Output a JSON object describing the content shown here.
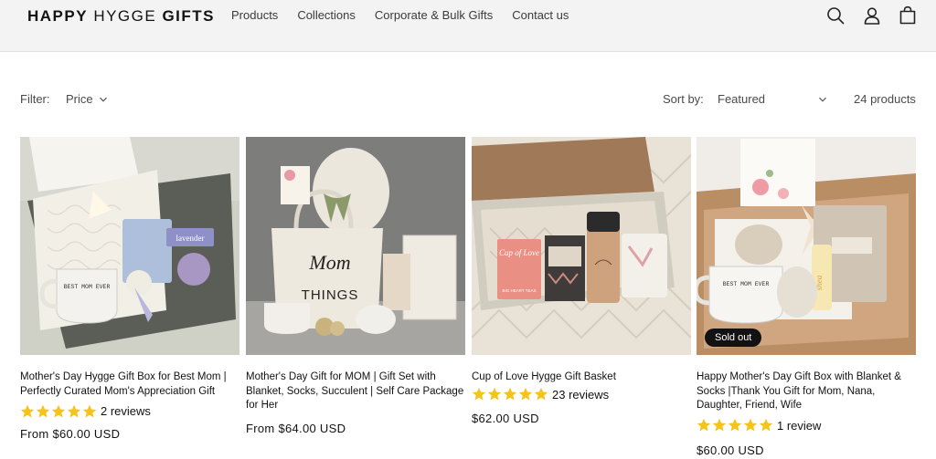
{
  "header": {
    "logo_bold": "HAPPY",
    "logo_light": "HYGGE",
    "logo_bold2": "GIFTS",
    "nav": [
      "Products",
      "Collections",
      "Corporate & Bulk Gifts",
      "Contact us"
    ],
    "icons": [
      "search-icon",
      "account-icon",
      "cart-icon"
    ]
  },
  "filters": {
    "filter_label": "Filter:",
    "price_label": "Price",
    "sort_label": "Sort by:",
    "sort_value": "Featured",
    "count": "24 products"
  },
  "colors": {
    "star": "#f5c41b",
    "badge_bg": "#121212",
    "header_bg": "#f3f3f3"
  },
  "products": [
    {
      "title": "Mother's Day Hygge Gift Box for Best Mom | Perfectly Curated Mom's Appreciation Gift",
      "stars": 5,
      "reviews": "2 reviews",
      "price": "From $60.00 USD",
      "badge": ""
    },
    {
      "title": "Mother's Day Gift for MOM | Gift Set with Blanket, Socks, Succulent | Self Care Package for Her",
      "stars": 0,
      "reviews": "",
      "price": "From $64.00 USD",
      "badge": ""
    },
    {
      "title": "Cup of Love Hygge Gift Basket",
      "stars": 5,
      "reviews": "23 reviews",
      "price": "$62.00 USD",
      "badge": ""
    },
    {
      "title": "Happy Mother's Day Gift Box with Blanket & Socks |Thank You Gift for Mom, Nana, Daughter, Friend, Wife",
      "stars": 5,
      "reviews": "1 review",
      "price": "$60.00 USD",
      "badge": "Sold out"
    }
  ],
  "image_text": {
    "p1_mug": "BEST MOM EVER",
    "p1_card": "lavender",
    "p2_bag1": "Mom",
    "p2_bag2": "THINGS",
    "p3_pkg1": "Cup of Love",
    "p3_pkg2": "BIG HEART TEAS",
    "p4_mug": "BEST MOM EVER",
    "p4_tube": "shea"
  }
}
